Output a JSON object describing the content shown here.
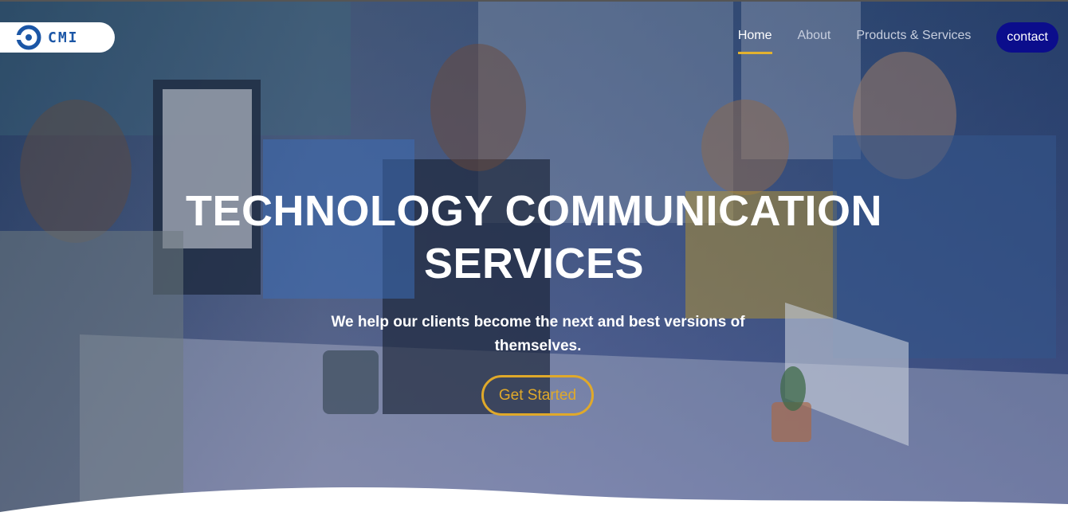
{
  "brand": {
    "name": "CMI",
    "logo_icon": "ring-logo-icon",
    "accent": "#1b56a6"
  },
  "nav": {
    "items": [
      {
        "label": "Home",
        "active": true
      },
      {
        "label": "About",
        "active": false
      },
      {
        "label": "Products & Services",
        "active": false
      }
    ],
    "contact_label": "contact",
    "contact_color": "#0b0d8c",
    "active_underline_color": "#e2b12f"
  },
  "hero": {
    "title_line1": "TECHNOLOGY COMMUNICATION",
    "title_line2": "SERVICES",
    "subtitle": "We help our clients become the next and best versions of themselves.",
    "cta_label": "Get Started",
    "cta_color": "#e0a92a"
  }
}
